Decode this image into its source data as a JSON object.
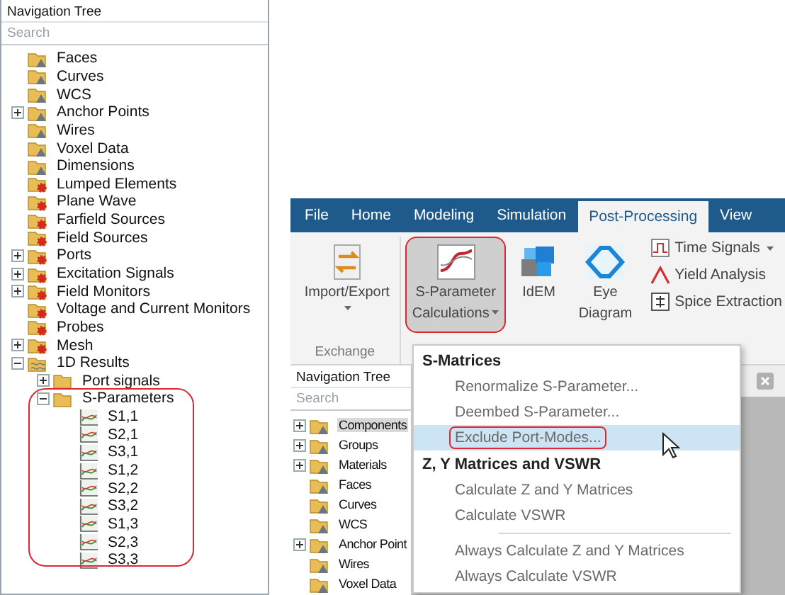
{
  "left_tree": {
    "title": "Navigation Tree",
    "search": {
      "placeholder": "Search"
    },
    "items": [
      {
        "label": "Faces",
        "kind": "folder-warning"
      },
      {
        "label": "Curves",
        "kind": "folder-warning"
      },
      {
        "label": "WCS",
        "kind": "folder-warning"
      },
      {
        "label": "Anchor Points",
        "kind": "folder-warning",
        "expanded": false
      },
      {
        "label": "Wires",
        "kind": "folder-warning"
      },
      {
        "label": "Voxel Data",
        "kind": "folder-warning"
      },
      {
        "label": "Dimensions",
        "kind": "folder-warning"
      },
      {
        "label": "Lumped Elements",
        "kind": "folder-gear"
      },
      {
        "label": "Plane Wave",
        "kind": "folder-gear"
      },
      {
        "label": "Farfield Sources",
        "kind": "folder-gear"
      },
      {
        "label": "Field Sources",
        "kind": "folder-gear"
      },
      {
        "label": "Ports",
        "kind": "folder-gear",
        "expanded": false
      },
      {
        "label": "Excitation Signals",
        "kind": "folder-gear",
        "expanded": false
      },
      {
        "label": "Field Monitors",
        "kind": "folder-gear",
        "expanded": false
      },
      {
        "label": "Voltage and Current Monitors",
        "kind": "folder-gear"
      },
      {
        "label": "Probes",
        "kind": "folder-gear"
      },
      {
        "label": "Mesh",
        "kind": "folder-gear",
        "expanded": false
      },
      {
        "label": "1D Results",
        "kind": "folder-results",
        "expanded": true,
        "children": [
          {
            "label": "Port signals",
            "kind": "folder",
            "expanded": false
          },
          {
            "label": "S-Parameters",
            "kind": "folder",
            "expanded": true,
            "highlighted": true,
            "children": [
              {
                "label": "S1,1",
                "kind": "curve"
              },
              {
                "label": "S2,1",
                "kind": "curve"
              },
              {
                "label": "S3,1",
                "kind": "curve"
              },
              {
                "label": "S1,2",
                "kind": "curve"
              },
              {
                "label": "S2,2",
                "kind": "curve"
              },
              {
                "label": "S3,2",
                "kind": "curve"
              },
              {
                "label": "S1,3",
                "kind": "curve"
              },
              {
                "label": "S2,3",
                "kind": "curve"
              },
              {
                "label": "S3,3",
                "kind": "curve"
              }
            ]
          }
        ]
      }
    ]
  },
  "ribbon": {
    "tabs": [
      {
        "label": "File",
        "selected": false
      },
      {
        "label": "Home",
        "selected": false
      },
      {
        "label": "Modeling",
        "selected": false
      },
      {
        "label": "Simulation",
        "selected": false
      },
      {
        "label": "Post-Processing",
        "selected": true
      },
      {
        "label": "View",
        "selected": false
      }
    ],
    "exchange_group": {
      "label": "Exchange",
      "button": {
        "lines": [
          "Import/Export"
        ],
        "dropdown": true,
        "pressed": false,
        "highlighted": false
      }
    },
    "large_buttons": [
      {
        "lines": [
          "S-Parameter",
          "Calculations"
        ],
        "dropdown": true,
        "pressed": true,
        "highlighted": true
      },
      {
        "lines": [
          "IdEM"
        ],
        "pressed": false,
        "highlighted": false
      },
      {
        "lines": [
          "Eye",
          "Diagram"
        ],
        "pressed": false,
        "highlighted": false
      }
    ],
    "small_buttons": [
      {
        "label": "Time Signals",
        "dropdown": true
      },
      {
        "label": "Yield Analysis"
      },
      {
        "label": "Spice Extraction"
      }
    ]
  },
  "right_tree": {
    "title": "Navigation Tree",
    "search": {
      "placeholder": "Search"
    },
    "items": [
      {
        "label": "Components",
        "expanded": false,
        "selected": true
      },
      {
        "label": "Groups",
        "expanded": false,
        "selected": false
      },
      {
        "label": "Materials",
        "expanded": false,
        "selected": false
      },
      {
        "label": "Faces",
        "selected": false
      },
      {
        "label": "Curves",
        "selected": false
      },
      {
        "label": "WCS",
        "selected": false
      },
      {
        "label": "Anchor Point",
        "expanded": false,
        "selected": false
      },
      {
        "label": "Wires",
        "selected": false
      },
      {
        "label": "Voxel Data",
        "selected": false
      }
    ]
  },
  "menu": {
    "items": [
      {
        "kind": "header",
        "label": "S-Matrices"
      },
      {
        "kind": "item",
        "label": "Renormalize S-Parameter...",
        "hovered": false,
        "highlighted": false
      },
      {
        "kind": "item",
        "label": "Deembed S-Parameter...",
        "hovered": false,
        "highlighted": false
      },
      {
        "kind": "item",
        "label": "Exclude Port-Modes...",
        "hovered": true,
        "highlighted": true
      },
      {
        "kind": "header",
        "label": "Z, Y Matrices and VSWR"
      },
      {
        "kind": "item",
        "label": "Calculate Z and Y Matrices",
        "hovered": false,
        "highlighted": false
      },
      {
        "kind": "item",
        "label": "Calculate VSWR",
        "hovered": false,
        "highlighted": false
      },
      {
        "kind": "separator"
      },
      {
        "kind": "item",
        "label": "Always Calculate Z and Y Matrices",
        "hovered": false,
        "highlighted": false
      },
      {
        "kind": "item",
        "label": "Always Calculate VSWR",
        "hovered": false,
        "highlighted": false
      }
    ]
  }
}
